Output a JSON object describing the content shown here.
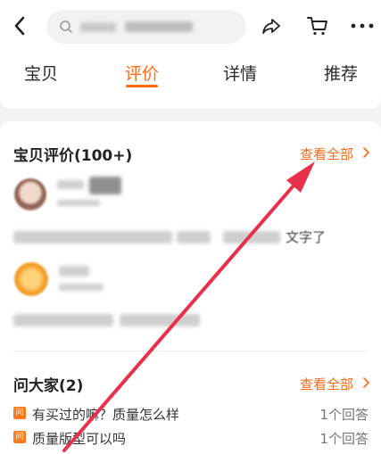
{
  "header": {
    "back_icon": "chevron-left-icon",
    "search_icon": "search-icon",
    "share_icon": "share-icon",
    "cart_icon": "cart-icon",
    "more_icon": "more-icon"
  },
  "tabs": [
    {
      "label": "宝贝",
      "active": false
    },
    {
      "label": "评价",
      "active": true
    },
    {
      "label": "详情",
      "active": false
    },
    {
      "label": "推荐",
      "active": false
    }
  ],
  "reviews": {
    "title": "宝贝评价(100+)",
    "view_all": "查看全部",
    "partial_text": "文字了"
  },
  "qa": {
    "title": "问大家(2)",
    "view_all": "查看全部",
    "icon_label": "问",
    "items": [
      {
        "question": "有买过的嘛？质量怎么样",
        "answers": "1个回答"
      },
      {
        "question": "质量版型可以吗",
        "answers": "1个回答"
      }
    ]
  },
  "colors": {
    "accent": "#ff6a13",
    "annotation_arrow": "#e8304a"
  }
}
